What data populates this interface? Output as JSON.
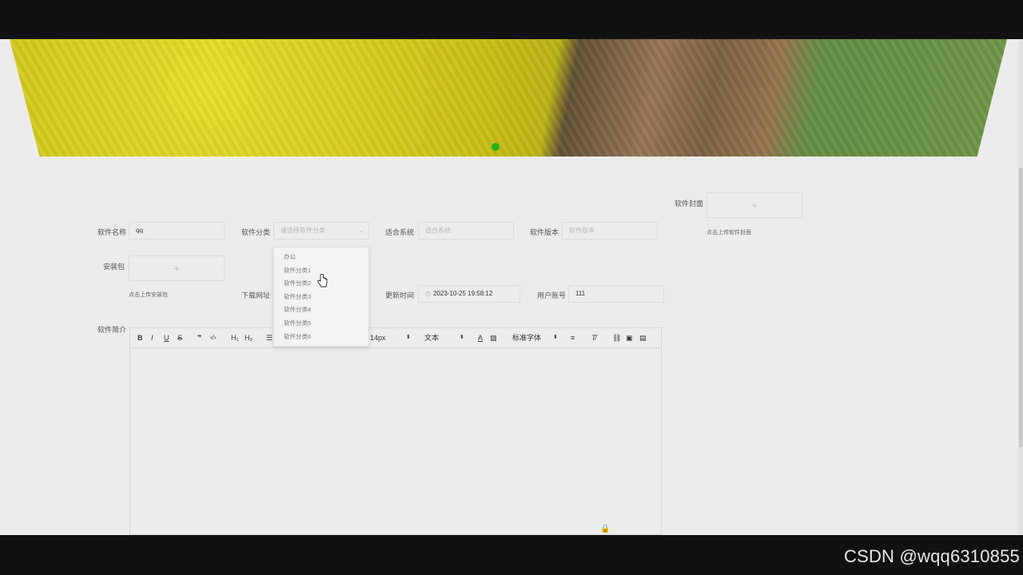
{
  "form": {
    "name_label": "软件名称",
    "name_value": "qq",
    "category_label": "软件分类",
    "category_placeholder": "请选择软件分类",
    "system_label": "适合系统",
    "system_placeholder": "适合系统",
    "version_label": "软件版本",
    "version_placeholder": "软件版本",
    "cover_label": "软件封面",
    "cover_hint": "点击上传软件封面",
    "package_label": "安装包",
    "package_hint": "点击上传安装包",
    "download_label": "下载网址",
    "update_label": "更新时间",
    "update_value": "2023-10-25 19:58:12",
    "account_label": "用户账号",
    "account_value": "111",
    "intro_label": "软件简介",
    "plus": "+"
  },
  "dropdown": {
    "options": [
      "办公",
      "软件分类1",
      "软件分类2",
      "软件分类3",
      "软件分类4",
      "软件分类5",
      "软件分类6"
    ]
  },
  "editor": {
    "toolbar": {
      "bold": "B",
      "italic": "I",
      "underline": "U",
      "strike": "S",
      "quote": "❞",
      "code": "‹/›",
      "h1": "H₁",
      "h2": "H₂",
      "font_size": "14px",
      "text_style": "文本",
      "font_family": "标准字体"
    }
  },
  "watermark": "CSDN @wqq6310855",
  "colors": {
    "background": "#ececec",
    "indicator_dot": "#27b11d"
  }
}
